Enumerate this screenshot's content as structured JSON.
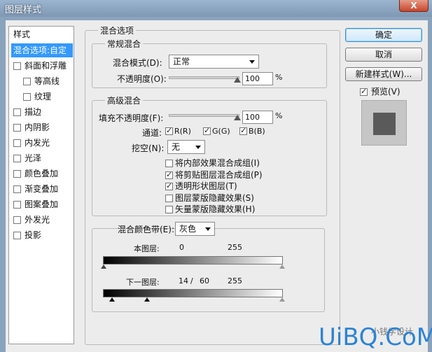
{
  "window": {
    "title": "图层样式",
    "close": "X"
  },
  "styles_label": "样式",
  "styles": [
    {
      "label": "混合选项:自定",
      "selected": true,
      "checkbox": false,
      "checked": false,
      "indent": false
    },
    {
      "label": "斜面和浮雕",
      "checkbox": true,
      "checked": false,
      "indent": false
    },
    {
      "label": "等高线",
      "checkbox": true,
      "checked": false,
      "indent": true
    },
    {
      "label": "纹理",
      "checkbox": true,
      "checked": false,
      "indent": true
    },
    {
      "label": "描边",
      "checkbox": true,
      "checked": false,
      "indent": false
    },
    {
      "label": "内阴影",
      "checkbox": true,
      "checked": false,
      "indent": false
    },
    {
      "label": "内发光",
      "checkbox": true,
      "checked": false,
      "indent": false
    },
    {
      "label": "光泽",
      "checkbox": true,
      "checked": false,
      "indent": false
    },
    {
      "label": "颜色叠加",
      "checkbox": true,
      "checked": false,
      "indent": false
    },
    {
      "label": "渐变叠加",
      "checkbox": true,
      "checked": false,
      "indent": false
    },
    {
      "label": "图案叠加",
      "checkbox": true,
      "checked": false,
      "indent": false
    },
    {
      "label": "外发光",
      "checkbox": true,
      "checked": false,
      "indent": false
    },
    {
      "label": "投影",
      "checkbox": true,
      "checked": false,
      "indent": false
    }
  ],
  "blend_options": {
    "title": "混合选项",
    "general": {
      "title": "常规混合",
      "mode_label": "混合模式(D):",
      "mode_value": "正常",
      "opacity_label": "不透明度(O):",
      "opacity_value": "100",
      "percent": "%"
    },
    "advanced": {
      "title": "高级混合",
      "fill_label": "填充不透明度(F):",
      "fill_value": "100",
      "percent": "%",
      "channels_label": "通道:",
      "channels": [
        {
          "label": "R(R)",
          "checked": true
        },
        {
          "label": "G(G)",
          "checked": true
        },
        {
          "label": "B(B)",
          "checked": true
        }
      ],
      "knockout_label": "挖空(N):",
      "knockout_value": "无",
      "options": [
        {
          "label": "将内部效果混合成组(I)",
          "checked": false
        },
        {
          "label": "将剪贴图层混合成组(P)",
          "checked": true
        },
        {
          "label": "透明形状图层(T)",
          "checked": true
        },
        {
          "label": "图层蒙版隐藏效果(S)",
          "checked": false
        },
        {
          "label": "矢量蒙版隐藏效果(H)",
          "checked": false
        }
      ]
    },
    "blend_if": {
      "label": "混合颜色带(E):",
      "value": "灰色",
      "this_layer_label": "本图层:",
      "this_layer_min": "0",
      "this_layer_max": "255",
      "underlying_label": "下一图层:",
      "underlying_low": "14",
      "slash": "/",
      "underlying_split": "60",
      "underlying_max": "255"
    }
  },
  "buttons": {
    "ok": "确定",
    "cancel": "取消",
    "new_style": "新建样式(W)...",
    "preview_label": "预览(V)",
    "preview_checked": true
  },
  "watermark": {
    "text": "UiBQ.CoM",
    "wechat": "小钱学设计"
  }
}
